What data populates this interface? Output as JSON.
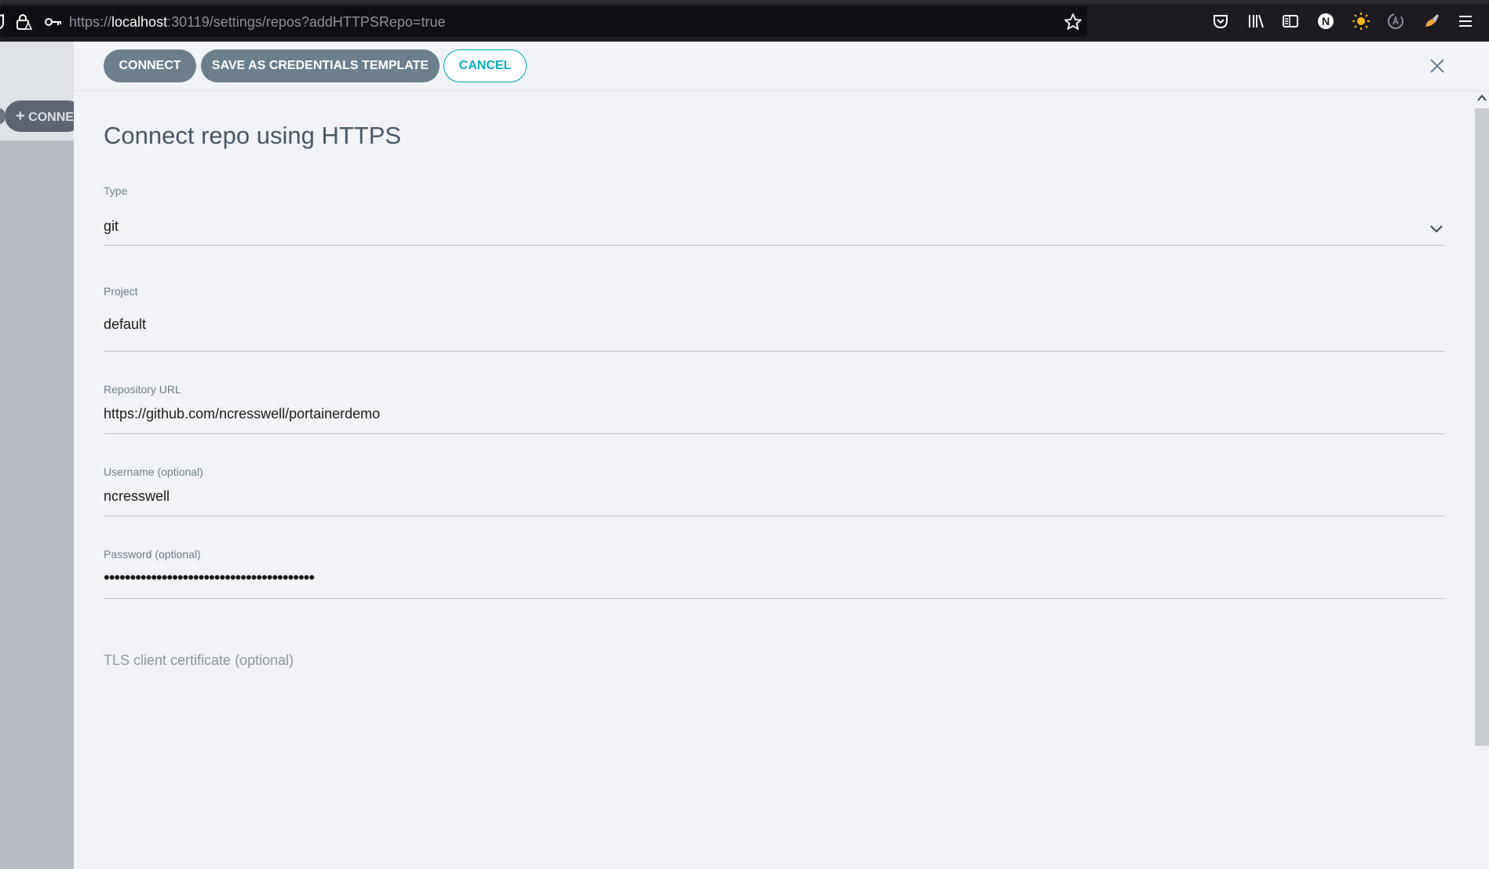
{
  "browser": {
    "url_prefix": "https://",
    "url_host": "localhost",
    "url_rest": ":30119/settings/repos?addHTTPSRepo=true",
    "profile_initial": "N"
  },
  "left_app": {
    "connect_label": "CONNE"
  },
  "toolbar": {
    "connect_label": "CONNECT",
    "save_template_label": "SAVE AS CREDENTIALS TEMPLATE",
    "cancel_label": "CANCEL"
  },
  "form": {
    "title": "Connect repo using HTTPS",
    "type": {
      "label": "Type",
      "value": "git"
    },
    "project": {
      "label": "Project",
      "value": "default"
    },
    "repo_url": {
      "label": "Repository URL",
      "value": "https://github.com/ncresswell/portainerdemo"
    },
    "username": {
      "label": "Username (optional)",
      "value": "ncresswell"
    },
    "password": {
      "label": "Password (optional)",
      "value": "••••••••••••••••••••••••••••••••••••••••"
    },
    "tls_label": "TLS client certificate (optional)"
  },
  "colors": {
    "primary_button": "#6d7f8b",
    "cancel_accent": "#00a2b3",
    "browser_dark": "#1c1b22"
  }
}
